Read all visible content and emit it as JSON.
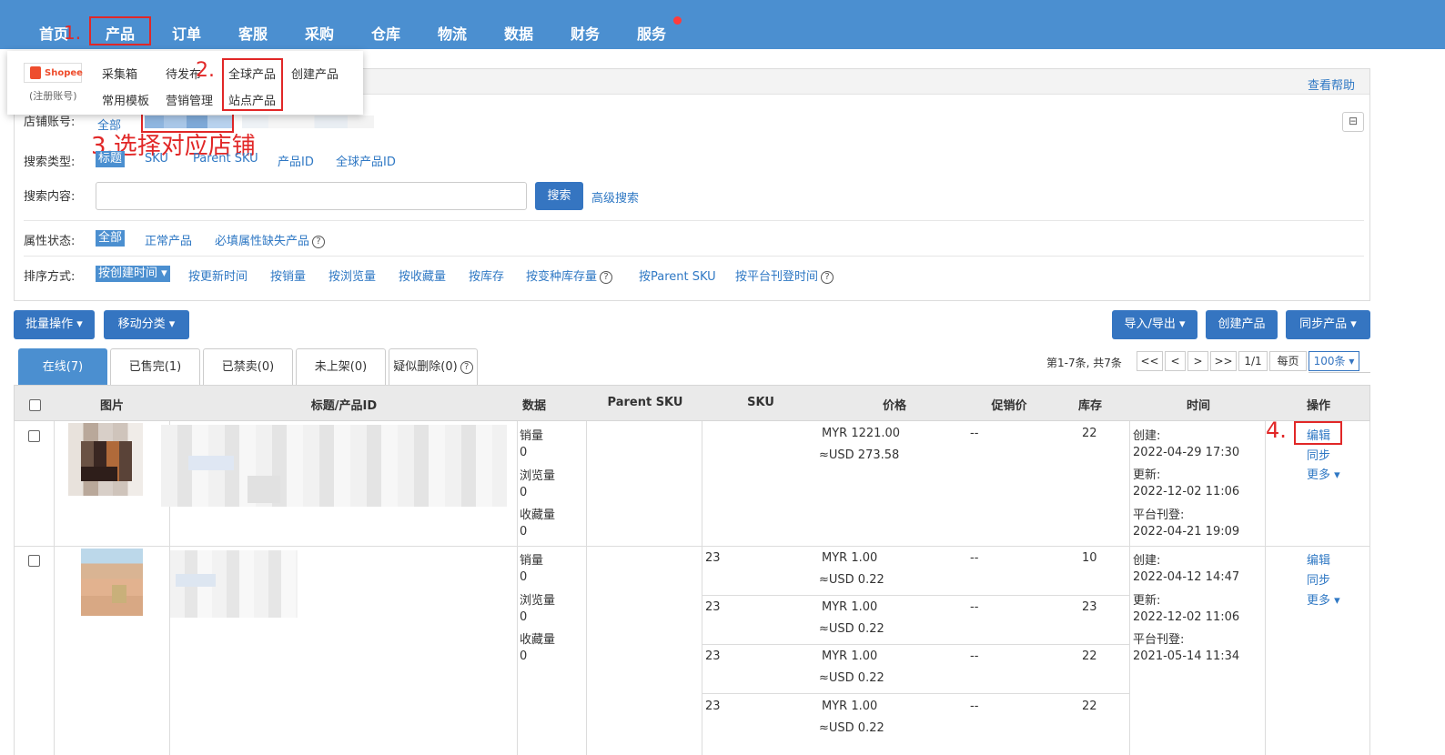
{
  "nav": {
    "items": [
      "首页",
      "产品",
      "订单",
      "客服",
      "采购",
      "仓库",
      "物流",
      "数据",
      "财务",
      "服务"
    ]
  },
  "annotations": {
    "step1": "1.",
    "step2": "2.",
    "step3": "3.选择对应店铺",
    "step4": "4."
  },
  "dropdown": {
    "shopee_logo": "Shopee",
    "shopee_note": "(注册账号)",
    "items": [
      "采集箱",
      "待发布",
      "全球产品",
      "创建产品",
      "常用模板",
      "营销管理",
      "站点产品"
    ]
  },
  "panel": {
    "help_link": "查看帮助",
    "store_label": "店铺账号:",
    "store_all": "全部",
    "search_type_label": "搜索类型:",
    "search_types": [
      "标题",
      "SKU",
      "Parent SKU",
      "产品ID",
      "全球产品ID"
    ],
    "search_content_label": "搜索内容:",
    "search_input_value": "",
    "search_button": "搜索",
    "advanced_search": "高级搜索",
    "attr_label": "属性状态:",
    "attr_options": [
      "全部",
      "正常产品",
      "必填属性缺失产品"
    ],
    "sort_label": "排序方式:",
    "sort_options": [
      "按创建时间",
      "按更新时间",
      "按销量",
      "按浏览量",
      "按收藏量",
      "按库存",
      "按变种库存量",
      "按Parent SKU",
      "按平台刊登时间"
    ]
  },
  "toolbar": {
    "bulk_action": "批量操作",
    "move_category": "移动分类",
    "import_export": "导入/导出",
    "create_product": "创建产品",
    "sync_product": "同步产品"
  },
  "tabs": [
    "在线(7)",
    "已售完(1)",
    "已禁卖(0)",
    "未上架(0)",
    "疑似删除(0)"
  ],
  "pagination": {
    "summary": "第1-7条, 共7条",
    "first": "<<",
    "prev": "<",
    "next": ">",
    "last": ">>",
    "page": "1/1",
    "per_page_label": "每页",
    "per_page": "100条"
  },
  "table": {
    "headers": [
      "图片",
      "标题/产品ID",
      "数据",
      "Parent SKU",
      "SKU",
      "价格",
      "促销价",
      "库存",
      "时间",
      "操作"
    ],
    "data_labels": [
      "销量",
      "浏览量",
      "收藏量"
    ],
    "time_labels": [
      "创建:",
      "更新:",
      "平台刊登:"
    ],
    "row_actions": [
      "编辑",
      "同步",
      "更多"
    ],
    "rows": [
      {
        "sales": "0",
        "views": "0",
        "favorites": "0",
        "created": "2022-04-29 17:30",
        "updated": "2022-12-02 11:06",
        "published": "2022-04-21 19:09",
        "variants": [
          {
            "sku": "",
            "price": "MYR  1221.00",
            "usd": "≈USD 273.58",
            "promo": "--",
            "stock": "22"
          }
        ]
      },
      {
        "sales": "0",
        "views": "0",
        "favorites": "0",
        "created": "2022-04-12 14:47",
        "updated": "2022-12-02 11:06",
        "published": "2021-05-14 11:34",
        "variants": [
          {
            "sku": "23",
            "price": "MYR  1.00",
            "usd": "≈USD 0.22",
            "promo": "--",
            "stock": "10"
          },
          {
            "sku": "23",
            "price": "MYR  1.00",
            "usd": "≈USD 0.22",
            "promo": "--",
            "stock": "23"
          },
          {
            "sku": "23",
            "price": "MYR  1.00",
            "usd": "≈USD 0.22",
            "promo": "--",
            "stock": "22"
          },
          {
            "sku": "23",
            "price": "MYR  1.00",
            "usd": "≈USD 0.22",
            "promo": "--",
            "stock": "22"
          }
        ]
      }
    ]
  }
}
